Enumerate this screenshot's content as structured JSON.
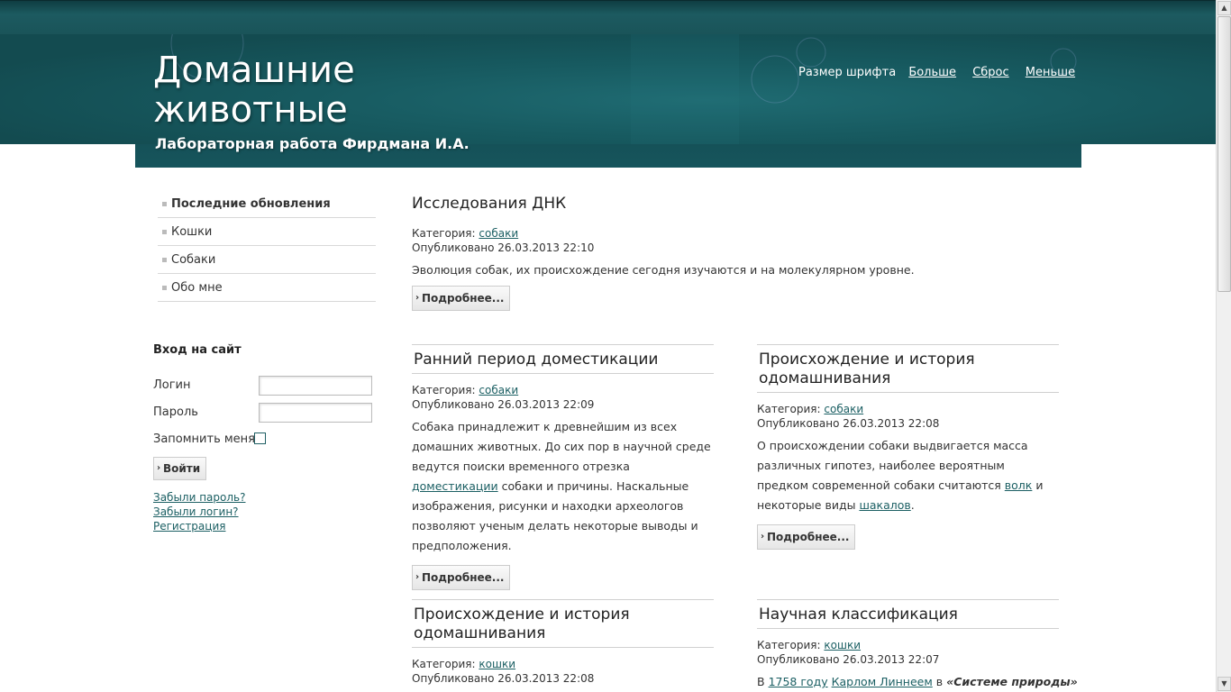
{
  "site": {
    "title": "Домашние животные",
    "subtitle": "Лабораторная работа Фирдмана И.А."
  },
  "font_size": {
    "label": "Размер шрифта",
    "bigger": "Больше",
    "reset": "Сброс",
    "smaller": "Меньше"
  },
  "menu": {
    "items": [
      {
        "label": "Последние обновления"
      },
      {
        "label": "Кошки"
      },
      {
        "label": "Собаки"
      },
      {
        "label": "Обо мне"
      }
    ]
  },
  "login": {
    "title": "Вход на сайт",
    "username_label": "Логин",
    "password_label": "Пароль",
    "remember_label": "Запомнить меня",
    "submit_label": "Войти",
    "forgot_password": "Забыли пароль?",
    "forgot_login": "Забыли логин?",
    "register": "Регистрация"
  },
  "articles": [
    {
      "title": "Исследования ДНК",
      "category_label": "Категория:",
      "category": "собаки",
      "published": "Опубликовано 26.03.2013 22:10",
      "text": "Эволюция собак, их происхождение сегодня изучаются и на молекулярном уровне.",
      "more": "Подробнее..."
    },
    {
      "title": "Ранний период доместикации",
      "category_label": "Категория:",
      "category": "собаки",
      "published": "Опубликовано 26.03.2013 22:09",
      "text_before": "Собака принадлежит к древнейшим из всех домашних животных. До сих пор в научной среде ведутся поиски временного отрезка ",
      "text_link": "доместикации",
      "text_after": " собаки и причины. Наскальные изображения, рисунки и находки археологов позволяют ученым делать некоторые выводы и предположения.",
      "more": "Подробнее..."
    },
    {
      "title": "Происхождение и история одомашнивания",
      "category_label": "Категория:",
      "category": "собаки",
      "published": "Опубликовано 26.03.2013 22:08",
      "text_before": "О происхождении собаки выдвигается масса различных гипотез, наиболее вероятным предком современной собаки считаются ",
      "text_link1": "волк",
      "text_middle": " и некоторые виды ",
      "text_link2": "шакалов",
      "text_after": ".",
      "more": "Подробнее..."
    },
    {
      "title": "Происхождение и история одомашнивания",
      "category_label": "Категория:",
      "category": "кошки",
      "published": "Опубликовано 26.03.2013 22:08"
    },
    {
      "title": "Научная классификация",
      "category_label": "Категория:",
      "category": "кошки",
      "published": "Опубликовано 26.03.2013 22:07",
      "text_before": "В ",
      "text_link1": "1758 году",
      "text_space": " ",
      "text_link2": "Карлом Линнеем",
      "text_middle": " в ",
      "text_italic": "«Системе природы»"
    }
  ],
  "scrollbar": {
    "up_icon": "arrow-up-icon",
    "down_icon": "arrow-down-icon"
  }
}
